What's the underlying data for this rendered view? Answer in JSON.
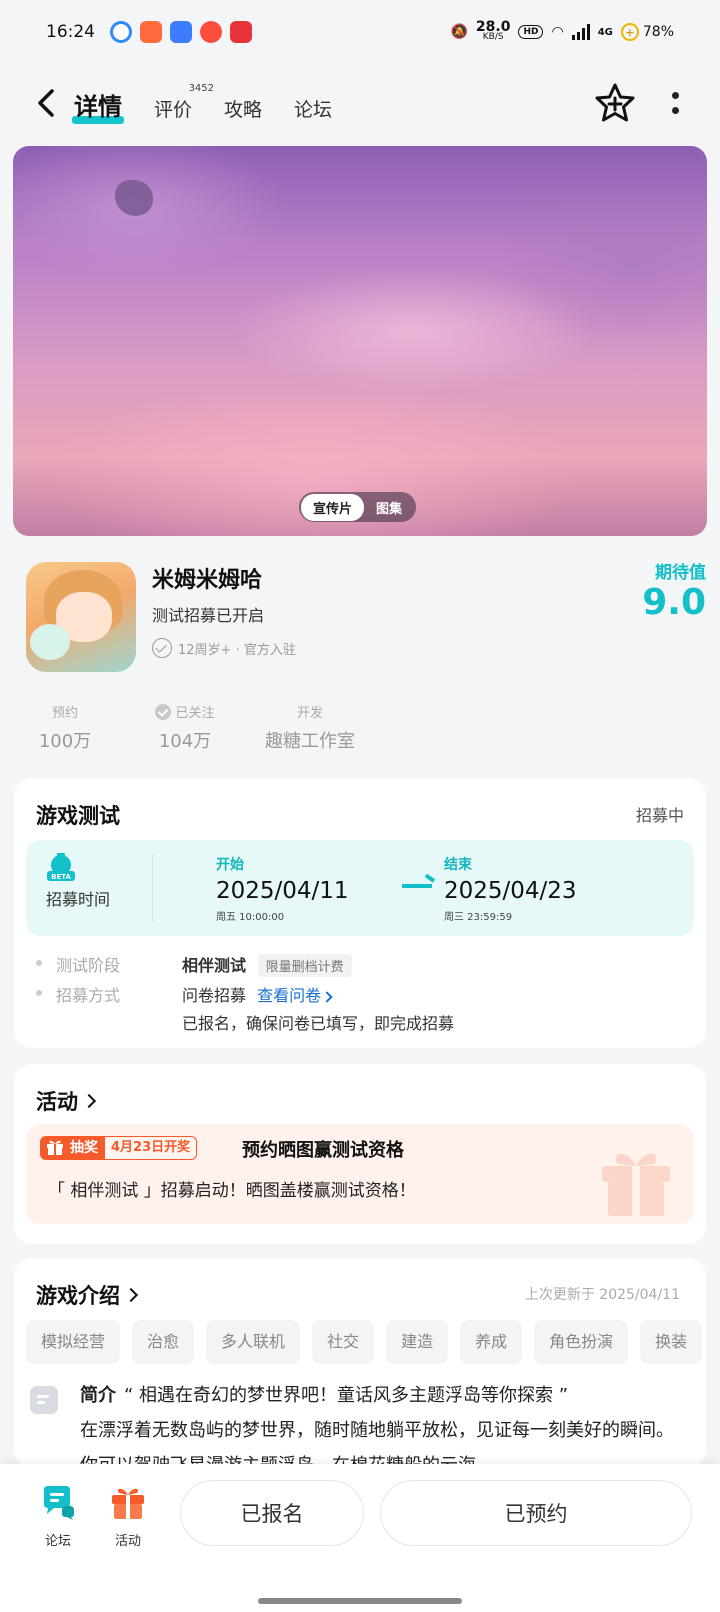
{
  "status_bar": {
    "time": "16:24",
    "net_speed": "28.0",
    "net_unit": "KB/S",
    "hd": "HD",
    "signal": "4G",
    "battery": "78%",
    "app_icon_colors": [
      "#2f8cff",
      "#ff6a3d",
      "#3d7bff",
      "#ff4d3d",
      "#e8333a"
    ]
  },
  "nav": {
    "tabs": [
      {
        "label": "详情",
        "active": true
      },
      {
        "label": "评价",
        "badge": "3452"
      },
      {
        "label": "攻略"
      },
      {
        "label": "论坛"
      }
    ]
  },
  "hero": {
    "toggle": [
      "宣传片",
      "图集"
    ]
  },
  "game": {
    "name": "米姆米姆哈",
    "subtitle": "测试招募已开启",
    "meta": "12周岁+ · 官方入驻",
    "rating_label": "期待值",
    "rating_value": "9.0"
  },
  "stats": [
    {
      "label": "预约",
      "value": "100万"
    },
    {
      "label": "已关注",
      "value": "104万"
    },
    {
      "label": "开发",
      "value": "趣糖工作室"
    }
  ],
  "test_card": {
    "title": "游戏测试",
    "status": "招募中",
    "recruit_label": "招募时间",
    "start": {
      "label": "开始",
      "date": "2025/04/11",
      "weekday_time": "周五 10:00:00"
    },
    "end": {
      "label": "结束",
      "date": "2025/04/23",
      "weekday_time": "周三 23:59:59"
    },
    "phase_label": "测试阶段",
    "phase_value": "相伴测试",
    "phase_tag": "限量删档计费",
    "method_label": "招募方式",
    "method_value": "问卷招募",
    "method_link": "查看问卷",
    "method_note": "已报名，确保问卷已填写，即完成招募"
  },
  "activity_card": {
    "title": "活动",
    "badge": "抽奖",
    "badge_date": "4月23日开奖",
    "headline": "预约晒图赢测试资格",
    "desc": "「 相伴测试 」招募启动！晒图盖楼赢测试资格！"
  },
  "intro_card": {
    "title": "游戏介绍",
    "updated": "上次更新于 2025/04/11",
    "tags": [
      "模拟经营",
      "治愈",
      "多人联机",
      "社交",
      "建造",
      "养成",
      "角色扮演",
      "换装"
    ],
    "intro_label": "简介",
    "intro_quote": "“ 相遇在奇幻的梦世界吧！童话风多主题浮岛等你探索 ”",
    "intro_body": "在漂浮着无数岛屿的梦世界，随时随地躺平放松，见证每一刻美好的瞬间。你可以驾驶飞星漫游主题浮岛，在棉花糖般的云海"
  },
  "bottom": {
    "forum_label": "论坛",
    "activity_label": "活动",
    "signed_up": "已报名",
    "reserved": "已预约"
  },
  "colors": {
    "accent": "#13c0c9",
    "orange": "#f45a2a",
    "link": "#1a6fd1"
  }
}
